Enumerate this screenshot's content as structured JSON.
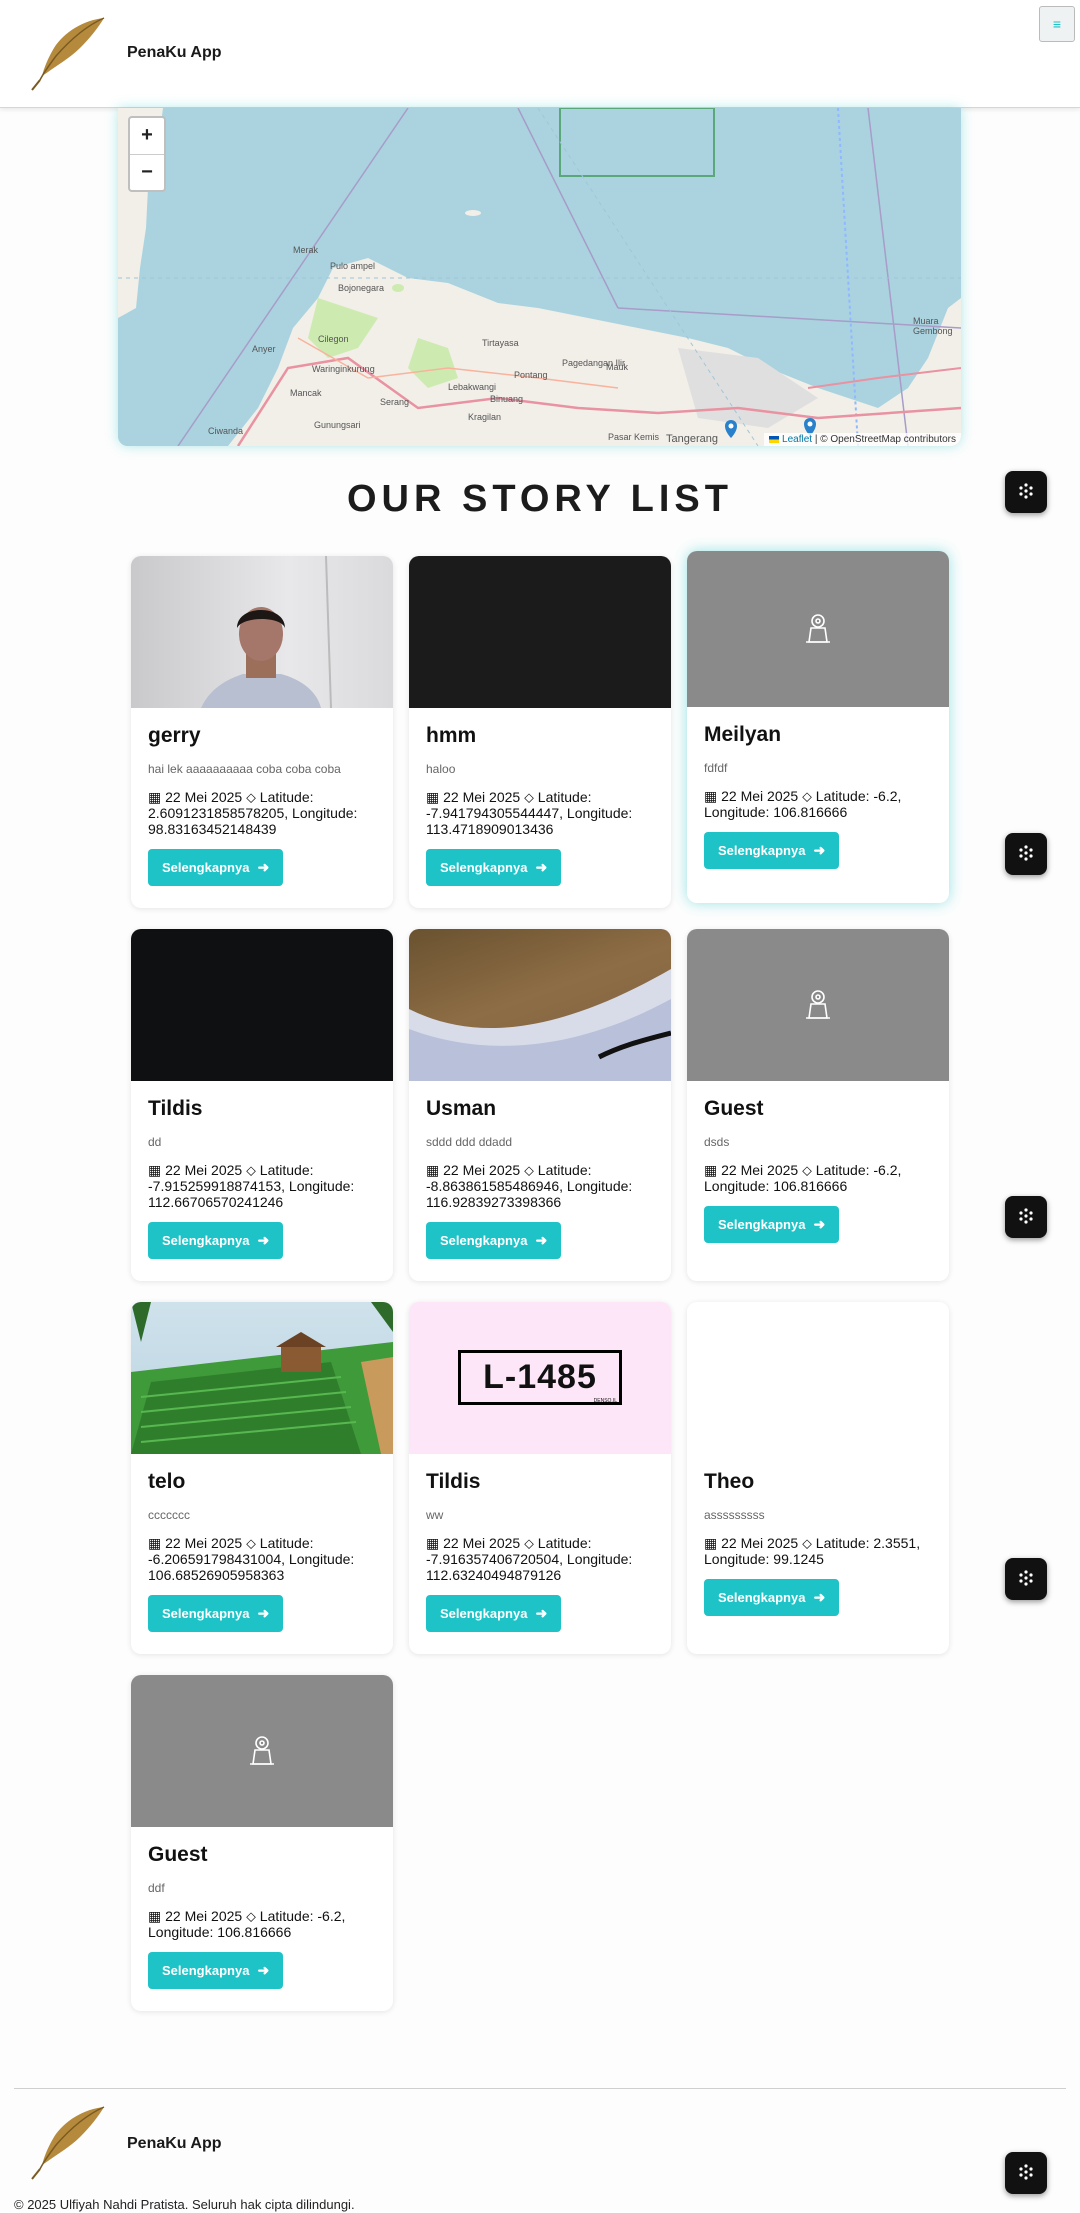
{
  "header": {
    "brand": "PenaKu App",
    "menu_icon": "≡"
  },
  "map": {
    "zoom_in": "+",
    "zoom_out": "−",
    "attribution_leaflet": "Leaflet",
    "attribution_rest": " | © OpenStreetMap contributors",
    "labels": [
      "Pulo ampel",
      "Merak",
      "Bojonegara",
      "Cilegon",
      "Anyer",
      "Waringinkurung",
      "Mancak",
      "Serang",
      "Tirtayasa",
      "Lebakwangi",
      "Kragilan",
      "Binuang",
      "Pontang",
      "Pagedangan Ilir",
      "Gunungsari",
      "Ciwanda",
      "Pasar Kemis",
      "Tangerang",
      "Muara Gembong",
      "Mauk"
    ]
  },
  "page_title": "OUR STORY LIST",
  "button_label": "Selengkapnya",
  "stories": [
    {
      "name": "gerry",
      "description": "hai lek aaaaaaaaaa coba coba coba",
      "date": "22 Mei 2025",
      "location": "Latitude: 2.6091231858578205, Longitude: 98.83163452148439",
      "image": "photo-person"
    },
    {
      "name": "hmm",
      "description": "haloo",
      "date": "22 Mei 2025",
      "location": "Latitude: -7.941794305544447, Longitude: 113.4718909013436",
      "image": "dark"
    },
    {
      "name": "Meilyan",
      "description": "fdfdf",
      "date": "22 Mei 2025",
      "location": "Latitude: -6.2, Longitude: 106.816666",
      "image": "placeholder"
    },
    {
      "name": "Tildis",
      "description": "dd",
      "date": "22 Mei 2025",
      "location": "Latitude: -7.915259918874153, Longitude: 112.66706570241246",
      "image": "dark"
    },
    {
      "name": "Usman",
      "description": "sddd ddd ddadd",
      "date": "22 Mei 2025",
      "location": "Latitude: -8.863861585486946, Longitude: 116.92839273398366",
      "image": "photo-ceiling"
    },
    {
      "name": "Guest",
      "description": "dsds",
      "date": "22 Mei 2025",
      "location": "Latitude: -6.2, Longitude: 106.816666",
      "image": "placeholder"
    },
    {
      "name": "telo",
      "description": "ccccccc",
      "date": "22 Mei 2025",
      "location": "Latitude: -6.206591798431004, Longitude: 106.68526905958363",
      "image": "photo-farm"
    },
    {
      "name": "Tildis",
      "description": "ww",
      "date": "22 Mei 2025",
      "location": "Latitude: -7.916357406720504, Longitude: 112.63240494879126",
      "image": "photo-plate",
      "plate_text": "L-1485",
      "plate_brand": "DENSO.IL"
    },
    {
      "name": "Theo",
      "description": "asssssssss",
      "date": "22 Mei 2025",
      "location": "Latitude: 2.3551, Longitude: 99.1245",
      "image": "blank"
    },
    {
      "name": "Guest",
      "description": "ddf",
      "date": "22 Mei 2025",
      "location": "Latitude: -6.2, Longitude: 106.816666",
      "image": "placeholder"
    }
  ],
  "widget_icon": "blackbox-icon",
  "footer": {
    "brand": "PenaKu App",
    "copyright": "© 2025 Ulfiyah Nahdi Pratista. Seluruh hak cipta dilindungi."
  },
  "colors": {
    "accent": "#1ec3c7",
    "placeholder": "#8a8a8a",
    "map_water": "#aad3df"
  }
}
